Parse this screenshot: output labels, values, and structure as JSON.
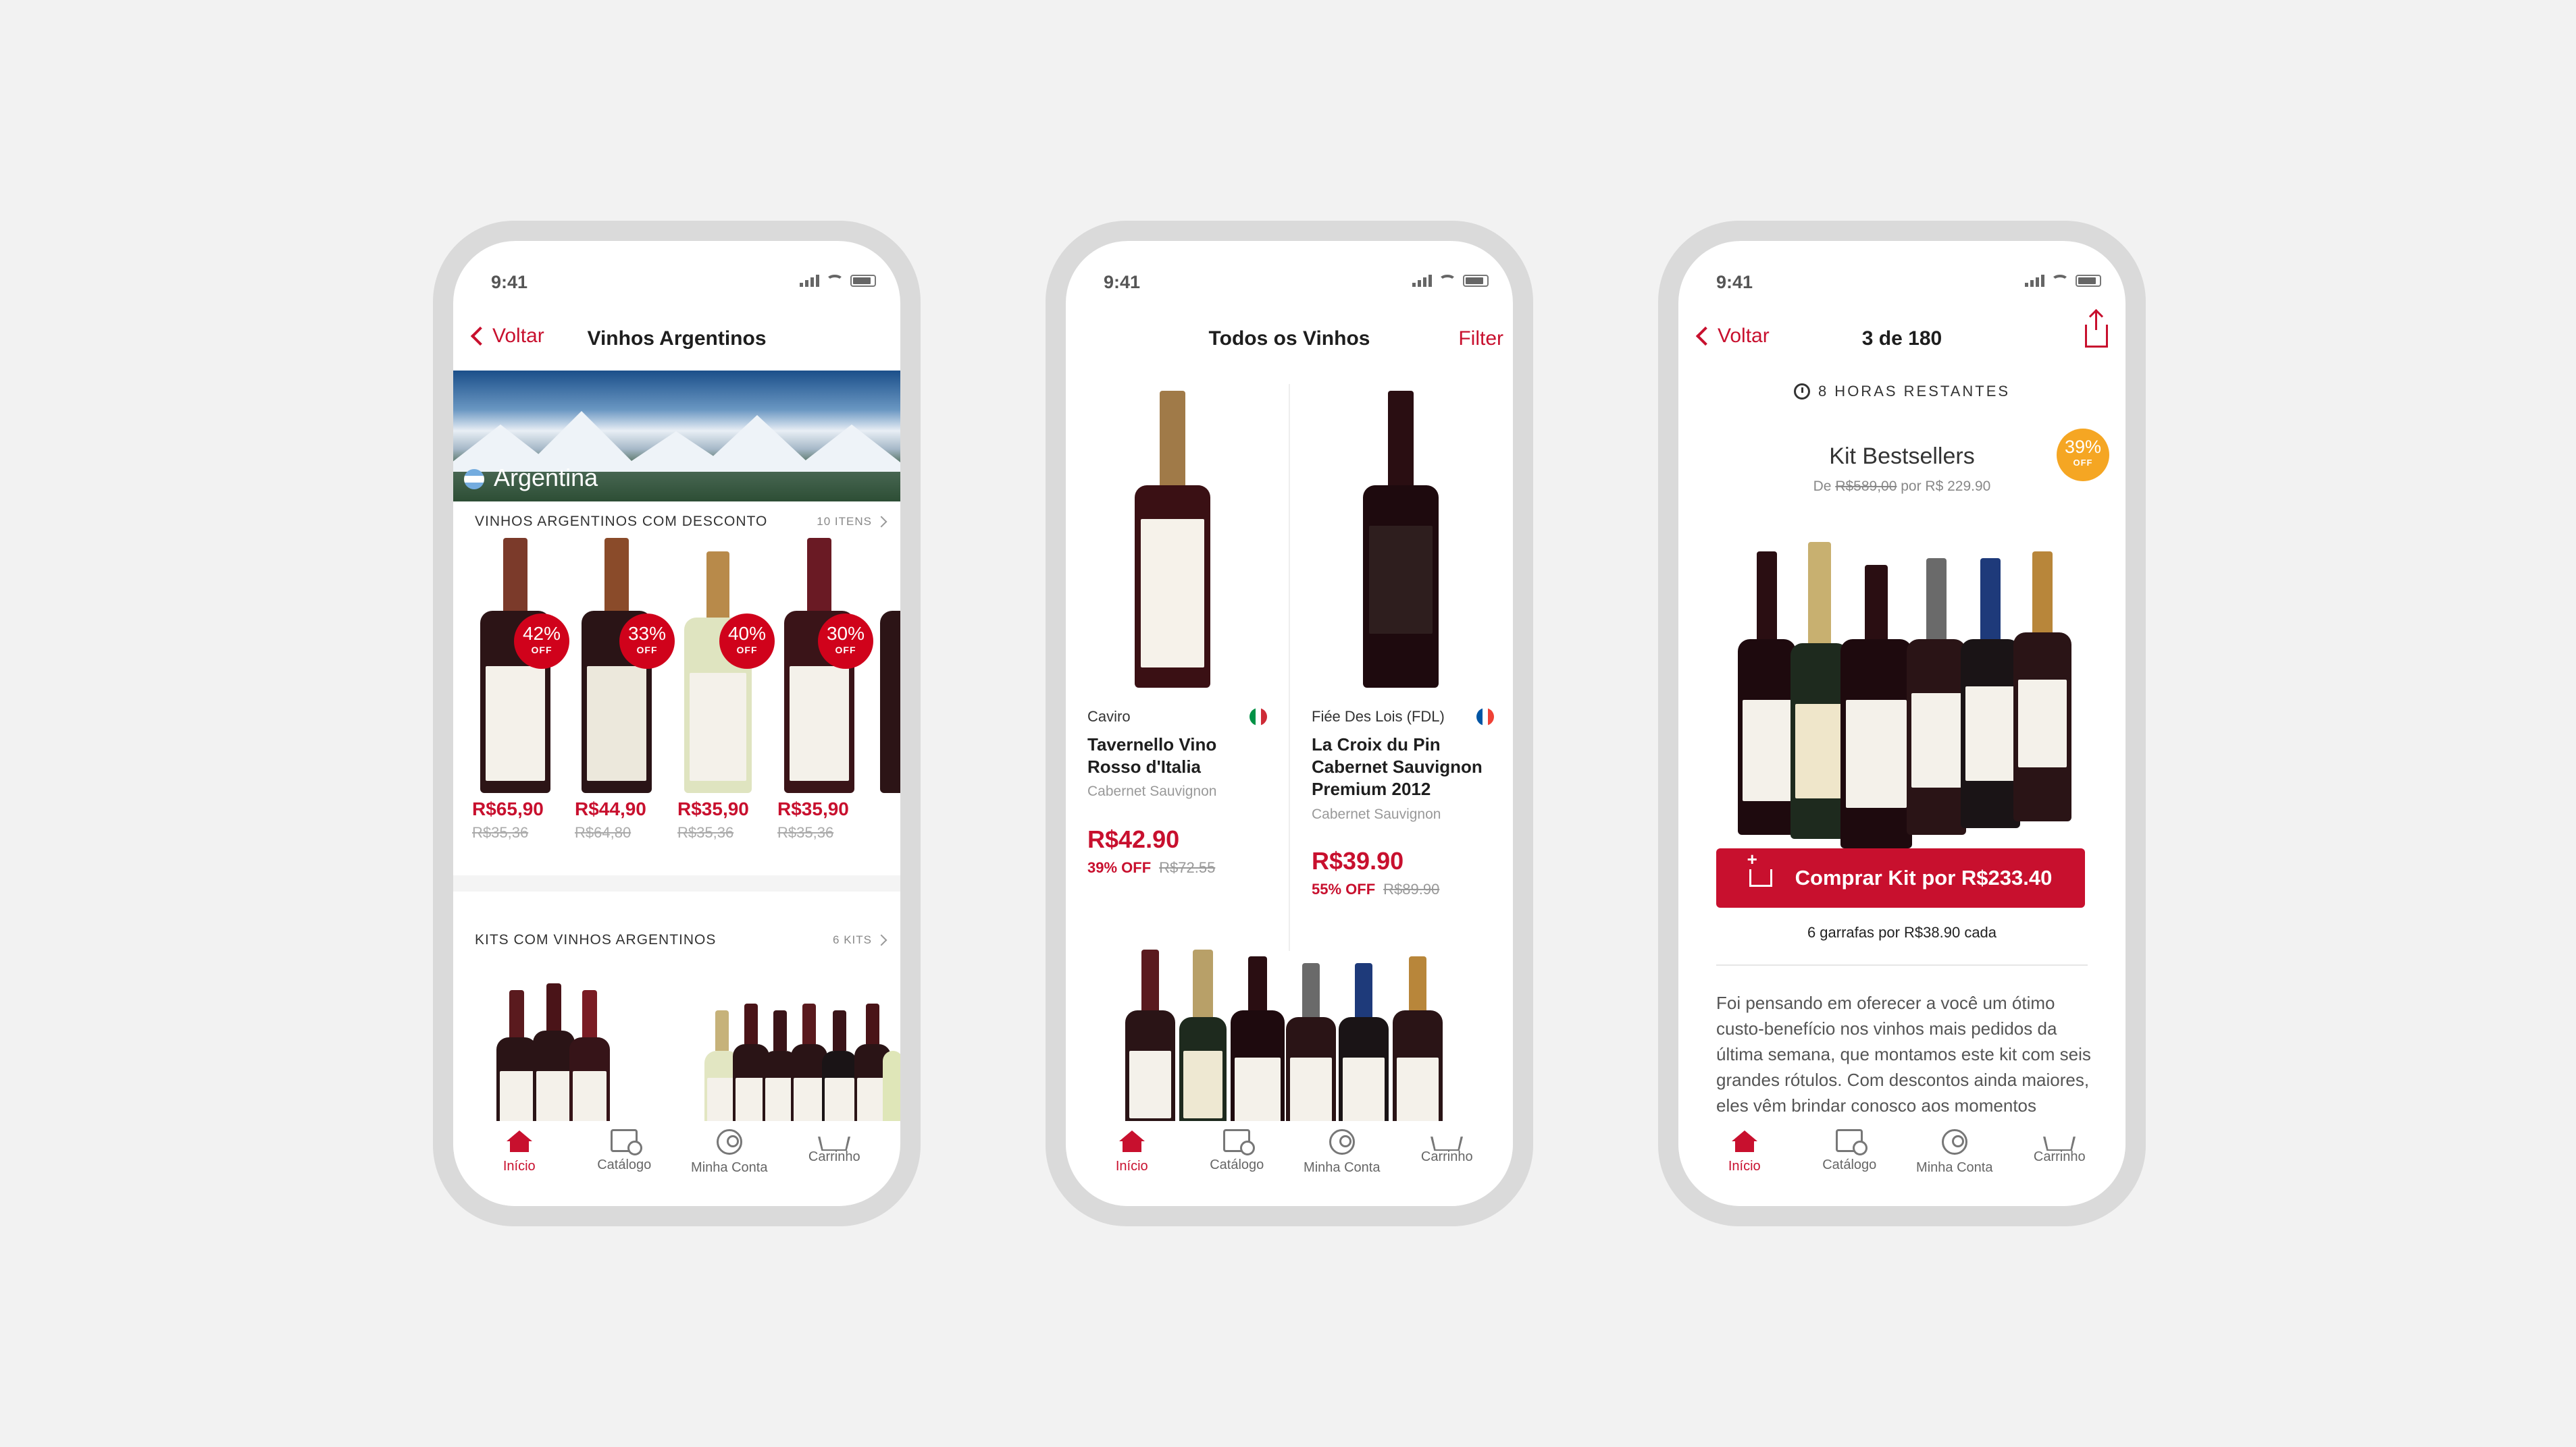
{
  "status_time": "9:41",
  "colors": {
    "accent": "#c8102e",
    "discount_badge": "#d0021b",
    "kit_badge": "#f5a623",
    "background": "#f2f2f2"
  },
  "phone1": {
    "back": "Voltar",
    "title": "Vinhos Argentinos",
    "hero_label": "Argentina",
    "section1": {
      "title": "VINHOS ARGENTINOS COM DESCONTO",
      "count": "10 ITENS"
    },
    "products": [
      {
        "discount": "42%",
        "off": "OFF",
        "price": "R$65,90",
        "old_price": "R$35,36"
      },
      {
        "discount": "33%",
        "off": "OFF",
        "price": "R$44,90",
        "old_price": "R$64,80"
      },
      {
        "discount": "40%",
        "off": "OFF",
        "price": "R$35,90",
        "old_price": "R$35,36"
      },
      {
        "discount": "30%",
        "off": "OFF",
        "price": "R$35,90",
        "old_price": "R$35,36"
      }
    ],
    "section2": {
      "title": "KITS COM VINHOS ARGENTINOS",
      "count": "6 KITS"
    }
  },
  "phone2": {
    "title": "Todos os Vinhos",
    "filter": "Filter",
    "wines": [
      {
        "producer": "Caviro",
        "name_line1": "Tavernello Vino",
        "name_line2": "Rosso d'Italia",
        "name_line3": "",
        "grape": "Cabernet Sauvignon",
        "price": "R$42.90",
        "off": "39% OFF",
        "old_price": "R$72.55",
        "flag": "italy-flag-icon"
      },
      {
        "producer": "Fiée Des Lois (FDL)",
        "name_line1": "La Croix du Pin",
        "name_line2": "Cabernet Sauvignon",
        "name_line3": "Premium 2012",
        "grape": "Cabernet Sauvignon",
        "price": "R$39.90",
        "off": "55% OFF",
        "old_price": "R$89.90",
        "flag": "france-flag-icon"
      }
    ]
  },
  "phone3": {
    "back": "Voltar",
    "title": "3 de 180",
    "countdown": "8 HORAS RESTANTES",
    "kit_title": "Kit Bestsellers",
    "kit_sub_prefix": "De",
    "kit_sub_old": "R$589,00",
    "kit_sub_mid": "por R$ 229.90",
    "badge_pct": "39%",
    "badge_off": "OFF",
    "buy_label": "Comprar Kit por R$233.40",
    "per_bottle": "6 garrafas por R$38.90 cada",
    "description": "Foi pensando em oferecer a você um ótimo custo-benefício nos vinhos mais pedidos da última semana, que montamos este kit com seis grandes rótulos. Com descontos ainda maiores, eles vêm brindar conosco aos momentos"
  },
  "tabs": [
    {
      "label": "Início",
      "icon": "home-icon"
    },
    {
      "label": "Catálogo",
      "icon": "catalog-icon"
    },
    {
      "label": "Minha Conta",
      "icon": "user-icon"
    },
    {
      "label": "Carrinho",
      "icon": "cart-icon"
    }
  ]
}
